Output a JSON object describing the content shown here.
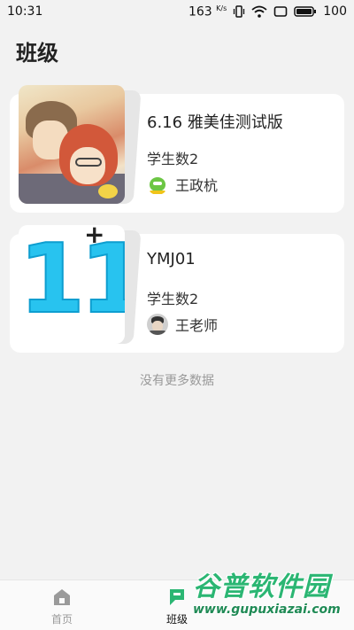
{
  "status_bar": {
    "time": "10:31",
    "speed": "163",
    "speed_unit": "K/s",
    "battery": "100"
  },
  "page": {
    "title": "班级"
  },
  "classes": [
    {
      "title": "6.16 雅美佳测试版",
      "count_label": "学生数2",
      "teacher": "王政杭",
      "cover": "anime-couple-illustration",
      "avatar": "green-cartoon-avatar"
    },
    {
      "title": "YMJ01",
      "count_label": "学生数2",
      "teacher": "王老师",
      "cover": "number-11-graphic",
      "cover_text": "11",
      "cover_mark": "+",
      "avatar": "man-photo-avatar"
    }
  ],
  "list_footer": "没有更多数据",
  "bottom_nav": {
    "items": [
      {
        "label": "首页",
        "icon": "home-icon",
        "active": false
      },
      {
        "label": "班级",
        "icon": "class-flag-icon",
        "active": true
      }
    ],
    "active_color": "#2bb673"
  },
  "watermark": {
    "line1": "谷普软件园",
    "line2": "www.gupuxiazai.com"
  }
}
